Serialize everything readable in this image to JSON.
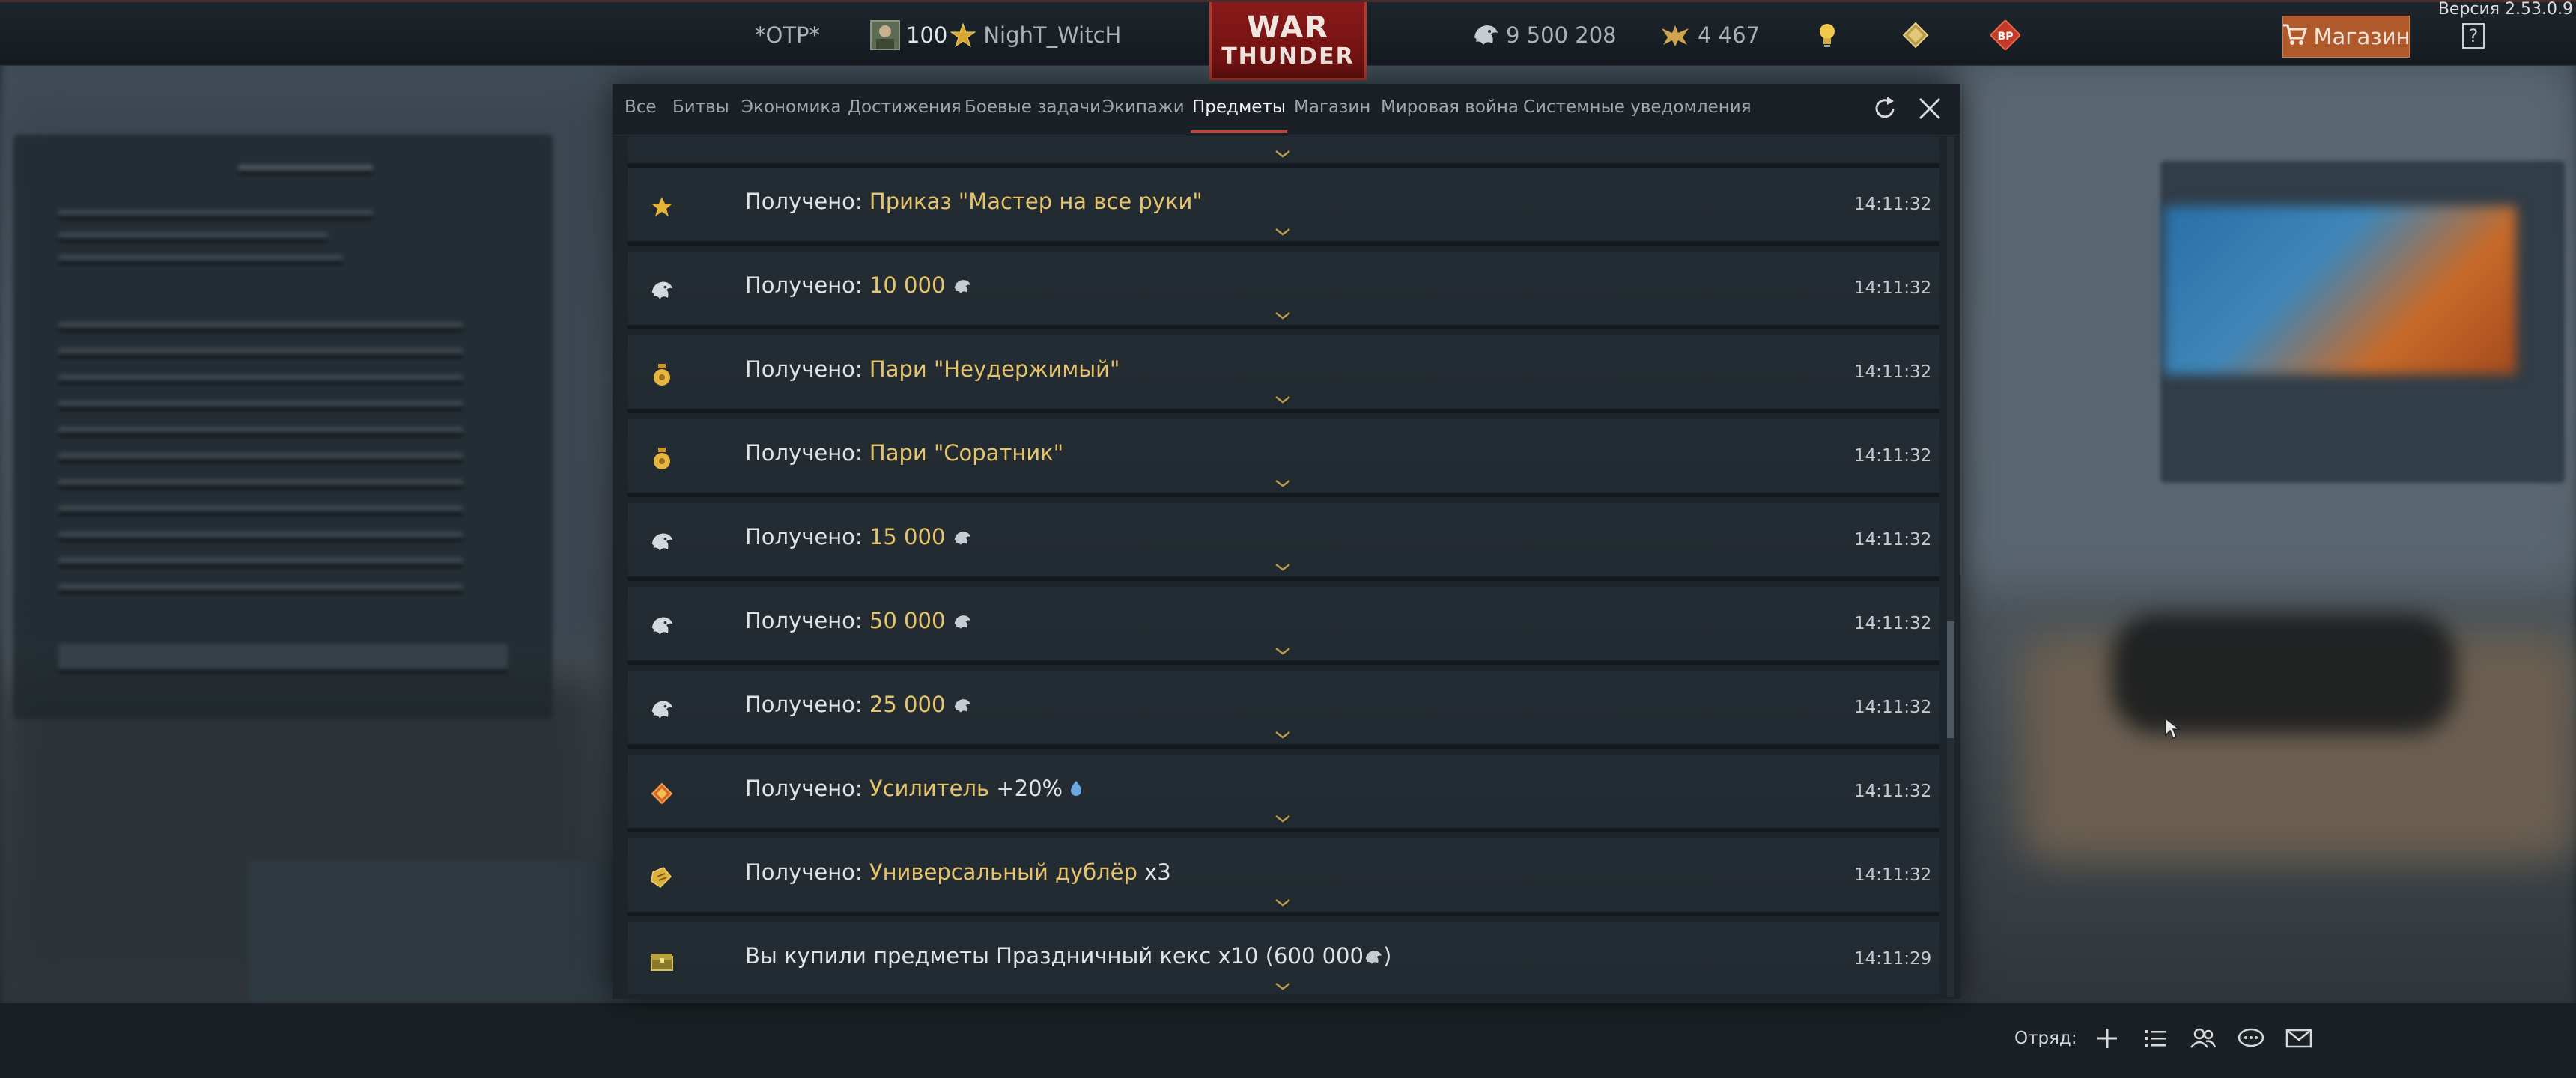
{
  "version": "Версия 2.53.0.9",
  "topbar": {
    "squadron": "*OTP*",
    "level": "100",
    "username": "NighT_WitcH",
    "logo_line1": "WAR",
    "logo_line2": "THUNDER",
    "silver_lions": "9 500 208",
    "golden_eagles": "4 467",
    "shop_label": "Магазин"
  },
  "window": {
    "tabs": [
      {
        "label": "Все"
      },
      {
        "label": "Битвы"
      },
      {
        "label": "Экономика"
      },
      {
        "label": "Достижения"
      },
      {
        "label": "Боевые задачи"
      },
      {
        "label": "Экипажи"
      },
      {
        "label": "Предметы",
        "active": true
      },
      {
        "label": "Магазин"
      },
      {
        "label": "Мировая война"
      },
      {
        "label": "Системные уведомления"
      }
    ],
    "rows": [
      {
        "icon": "star-icon",
        "prefix": "Получено: ",
        "item": "Приказ \"Мастер на все руки\"",
        "suffix": "",
        "time": "14:11:32"
      },
      {
        "icon": "silver-lion-icon",
        "prefix": "Получено: ",
        "item": "10 000",
        "suffix": "",
        "time": "14:11:32"
      },
      {
        "icon": "bet-icon",
        "prefix": "Получено: ",
        "item": "Пари \"Неудержимый\"",
        "suffix": "",
        "time": "14:11:32"
      },
      {
        "icon": "bet-icon",
        "prefix": "Получено: ",
        "item": "Пари \"Соратник\"",
        "suffix": "",
        "time": "14:11:32"
      },
      {
        "icon": "silver-lion-icon",
        "prefix": "Получено: ",
        "item": "15 000",
        "suffix": "",
        "time": "14:11:32"
      },
      {
        "icon": "silver-lion-icon",
        "prefix": "Получено: ",
        "item": "50 000",
        "suffix": "",
        "time": "14:11:32"
      },
      {
        "icon": "silver-lion-icon",
        "prefix": "Получено: ",
        "item": "25 000",
        "suffix": "",
        "time": "14:11:32"
      },
      {
        "icon": "booster-icon",
        "prefix": "Получено: ",
        "item": "Усилитель",
        "suffix": " +20%",
        "time": "14:11:32"
      },
      {
        "icon": "backup-icon",
        "prefix": "Получено: ",
        "item": "Универсальный дублёр",
        "suffix": " x3",
        "time": "14:11:32"
      },
      {
        "icon": "chest-icon",
        "prefix": "Вы купили предметы Праздничный кекс x10 (600 000",
        "item": "",
        "suffix": ")",
        "time": "14:11:29"
      }
    ]
  },
  "bottombar": {
    "squad_label": "Отряд:"
  },
  "colors": {
    "accent_gold": "#e5c46c",
    "tab_underline": "#c8402a",
    "shop_button": "#b05a2c"
  }
}
